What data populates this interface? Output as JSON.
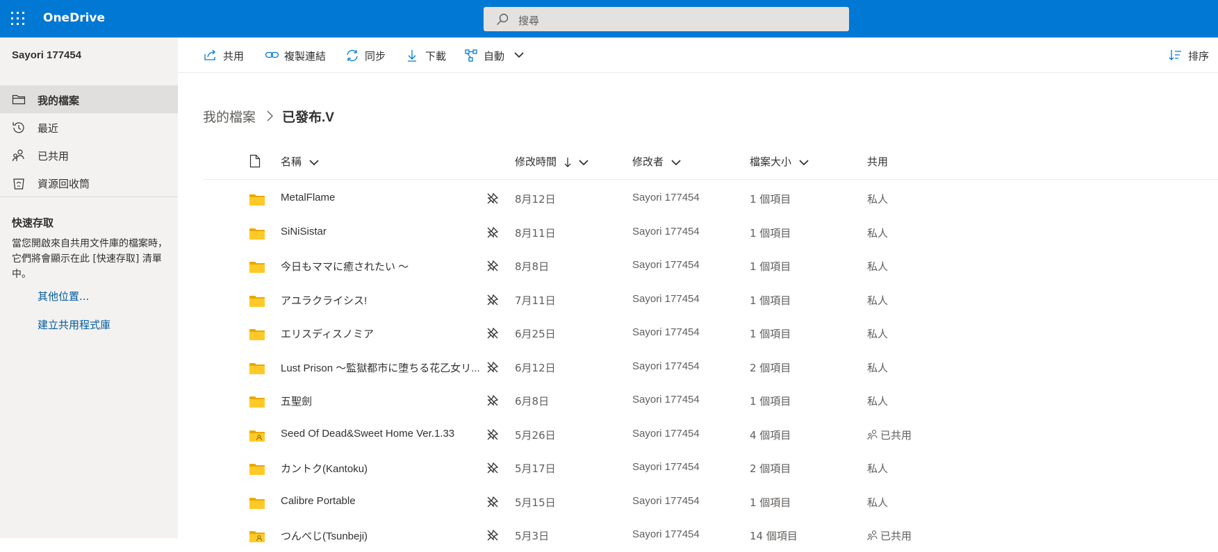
{
  "app": {
    "name": "OneDrive"
  },
  "search": {
    "placeholder": "搜尋"
  },
  "sidebar": {
    "account": "Sayori 177454",
    "items": [
      {
        "label": "我的檔案",
        "icon": "folder-icon",
        "active": true
      },
      {
        "label": "最近",
        "icon": "history-icon"
      },
      {
        "label": "已共用",
        "icon": "people-icon"
      },
      {
        "label": "資源回收筒",
        "icon": "recycle-bin-icon"
      }
    ],
    "quick_access": {
      "title": "快速存取",
      "description": "當您開啟來自共用文件庫的檔案時，它們將會顯示在此 [快速存取] 清單中。",
      "links": [
        "其他位置...",
        "建立共用程式庫"
      ]
    }
  },
  "commands": {
    "share": "共用",
    "copy_link": "複製連結",
    "sync": "同步",
    "download": "下載",
    "automate": "自動",
    "sort": "排序"
  },
  "breadcrumb": {
    "root": "我的檔案",
    "current": "已發布.V"
  },
  "list": {
    "columns": {
      "name": "名稱",
      "modified": "修改時間",
      "modified_by": "修改者",
      "size": "檔案大小",
      "sharing": "共用"
    },
    "rows": [
      {
        "name": "MetalFlame",
        "modified": "8月12日",
        "modified_by": "Sayori 177454",
        "size": "1 個項目",
        "sharing": "私人",
        "shared": false
      },
      {
        "name": "SiNiSistar",
        "modified": "8月11日",
        "modified_by": "Sayori 177454",
        "size": "1 個項目",
        "sharing": "私人",
        "shared": false
      },
      {
        "name": "今日もママに癒されたい ～",
        "modified": "8月8日",
        "modified_by": "Sayori 177454",
        "size": "1 個項目",
        "sharing": "私人",
        "shared": false
      },
      {
        "name": "アユラクライシス!",
        "modified": "7月11日",
        "modified_by": "Sayori 177454",
        "size": "1 個項目",
        "sharing": "私人",
        "shared": false
      },
      {
        "name": "エリスディスノミア",
        "modified": "6月25日",
        "modified_by": "Sayori 177454",
        "size": "1 個項目",
        "sharing": "私人",
        "shared": false
      },
      {
        "name": "Lust Prison ～監獄都市に堕ちる花乙女リ...",
        "modified": "6月12日",
        "modified_by": "Sayori 177454",
        "size": "2 個項目",
        "sharing": "私人",
        "shared": false
      },
      {
        "name": "五聖劍",
        "modified": "6月8日",
        "modified_by": "Sayori 177454",
        "size": "1 個項目",
        "sharing": "私人",
        "shared": false
      },
      {
        "name": "Seed Of Dead&Sweet Home Ver.1.33",
        "modified": "5月26日",
        "modified_by": "Sayori 177454",
        "size": "4 個項目",
        "sharing": "已共用",
        "shared": true
      },
      {
        "name": "カントク(Kantoku)",
        "modified": "5月17日",
        "modified_by": "Sayori 177454",
        "size": "2 個項目",
        "sharing": "私人",
        "shared": false
      },
      {
        "name": "Calibre Portable",
        "modified": "5月15日",
        "modified_by": "Sayori 177454",
        "size": "1 個項目",
        "sharing": "私人",
        "shared": false
      },
      {
        "name": "つんべじ(Tsunbeji)",
        "modified": "5月3日",
        "modified_by": "Sayori 177454",
        "size": "14 個項目",
        "sharing": "已共用",
        "shared": true
      }
    ]
  },
  "colors": {
    "brand": "#0078d4",
    "folder": "#ffca28",
    "sidebar_bg": "#f3f2f1",
    "link": "#005a9e"
  }
}
